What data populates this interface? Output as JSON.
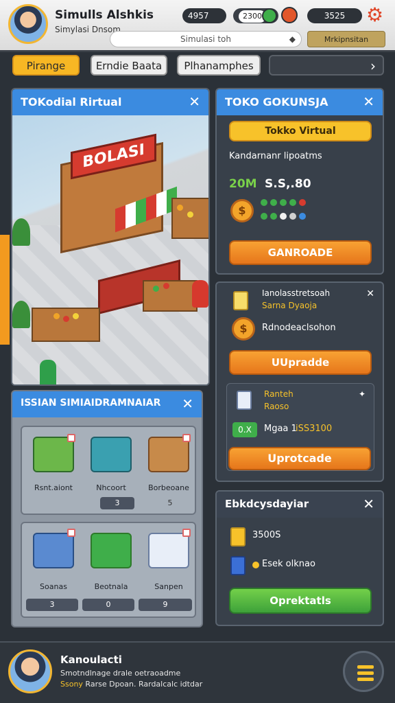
{
  "header": {
    "player_name": "Simulls Alshkis",
    "player_sub": "Simylasi Dnsom",
    "stat_1": "4957",
    "stat_2": "2300",
    "stat_3": "3525",
    "search_placeholder": "Simulasi toh",
    "market_label": "Mrkipnsitan"
  },
  "tabs": [
    "Pirange",
    "Erndie Baata",
    "Plhanamphes",
    "›"
  ],
  "scene_panel": {
    "title": "TOKodial Rirtual",
    "store_sign": "BOLASI"
  },
  "toko_panel": {
    "title": "TOKO GOKUNSJA",
    "shop_button": "Tokko Virtual",
    "subtitle": "Kandarnanr lipoatms",
    "amount_left": "20M",
    "amount_right": "S.S,.80",
    "action_button": "GANROADE",
    "dot_colors_row1": [
      "#3fae4a",
      "#3fae4a",
      "#3fae4a",
      "#3fae4a",
      "#d63b2f"
    ],
    "dot_colors_row2": [
      "#3fae4a",
      "#3fae4a",
      "#f0f0f0",
      "#d0d0d0",
      "#3b8be0"
    ]
  },
  "upgrade_panel": {
    "row1_title": "Ianolasstretsoah",
    "row1_sub": "Sarna Dyaoja",
    "row2_text": "Rdnodeaclsohon",
    "button_1": "UUpradde",
    "sub_title": "Ranteh",
    "sub_sub": "Raoso",
    "sub_badge": "0.X",
    "sub_value_label": "Mgaa 1",
    "sub_value": "iSS3100",
    "button_2": "Uprotcade"
  },
  "options_panel": {
    "title": "Ebkdcysdayiar",
    "row1": "3500S",
    "row2": "Esek olknao",
    "button": "Oprektatls"
  },
  "inventory_panel": {
    "title": "ISSIAN SIMIAIDRAMNAIAR",
    "items_top": [
      {
        "label": "Rsnt.aiont",
        "tag": ""
      },
      {
        "label": "Nhcoort",
        "tag": "3"
      },
      {
        "label": "Borbeoane",
        "tag": "5"
      }
    ],
    "items_bottom": [
      {
        "label": "Soanas",
        "tag": "3"
      },
      {
        "label": "Beotnala",
        "tag": "0"
      },
      {
        "label": "Sanpen",
        "tag": "9"
      }
    ]
  },
  "footer": {
    "name": "Kanoulacti",
    "line1": "Smotndlnage drale oetraoadme",
    "line2_highlight": "Ssony",
    "line2_rest": " Rarse Dpoan. Rardalcalc idtdar"
  }
}
